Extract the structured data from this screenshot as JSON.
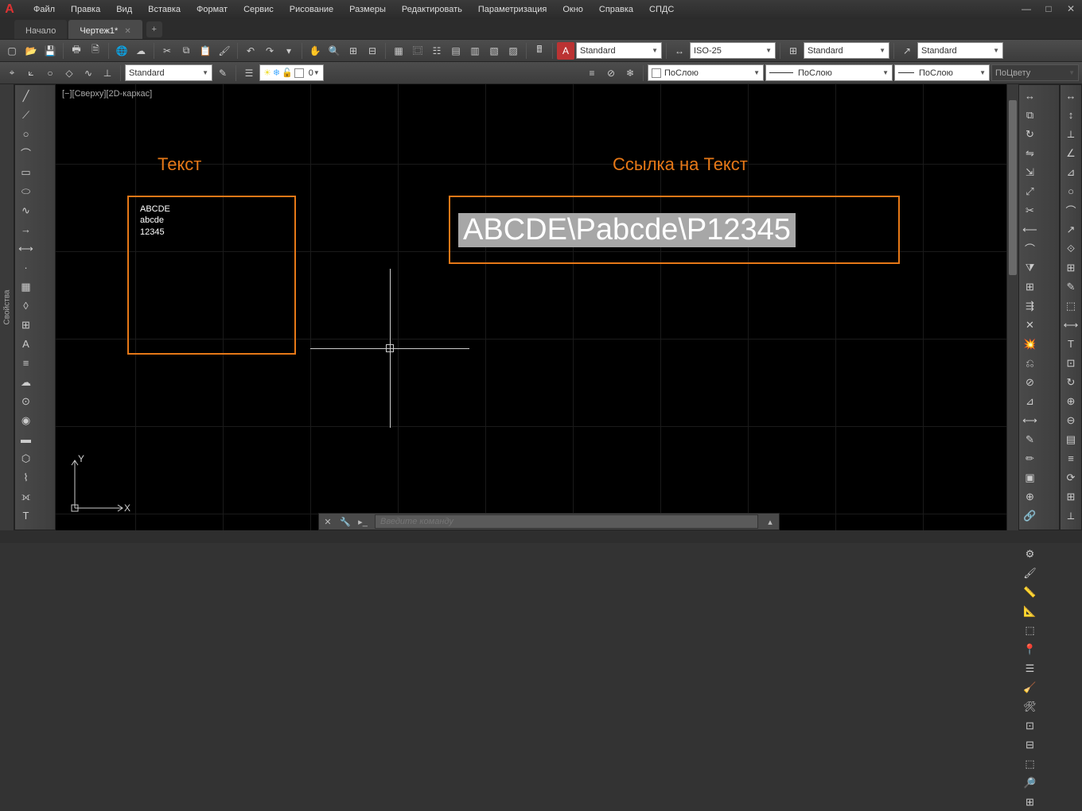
{
  "menu": [
    "Файл",
    "Правка",
    "Вид",
    "Вставка",
    "Формат",
    "Сервис",
    "Рисование",
    "Размеры",
    "Редактировать",
    "Параметризация",
    "Окно",
    "Справка",
    "СПДС"
  ],
  "tabs": {
    "start": "Начало",
    "active": "Чертеж1*"
  },
  "toolbar1": {
    "textStyle": "Standard",
    "dimStyle": "ISO-25",
    "tableStyle": "Standard",
    "mleaderStyle": "Standard"
  },
  "toolbar2": {
    "layerStyle": "Standard",
    "layerState": "0",
    "colorBy": "ПоСлою",
    "linetypeBy": "ПоСлою",
    "lineweightBy": "ПоСлою",
    "plotBy": "ПоЦвету"
  },
  "sidePanel": "Свойства",
  "viewport": "[−][Сверху][2D-каркас]",
  "labels": {
    "text": "Текст",
    "link": "Ссылка на Текст"
  },
  "mtext": {
    "l1": "ABCDE",
    "l2": "abcde",
    "l3": "12345"
  },
  "fieldText": "ABCDE\\Pabcde\\P12345",
  "ucs": {
    "x": "X",
    "y": "Y"
  },
  "cmd": {
    "placeholder": "Введите команду"
  },
  "icons": {
    "left": [
      "line",
      "polyline",
      "circle",
      "arc",
      "rect",
      "ellipse",
      "spline",
      "ray",
      "xline",
      "point",
      "hatch",
      "region",
      "table",
      "mtext",
      "mline",
      "revcloud",
      "wipeout",
      "donut",
      "solid",
      "boundary",
      "helix",
      "3dpoly",
      "text",
      "A"
    ],
    "right_a": [
      "move",
      "copy",
      "rotate",
      "mirror",
      "stretch",
      "scale",
      "trim",
      "extend",
      "fillet",
      "chamfer",
      "array",
      "offset",
      "erase",
      "explode",
      "join",
      "break",
      "align",
      "lengthen",
      "ped",
      "sped",
      "block",
      "insert",
      "xref",
      "layer",
      "prop",
      "match",
      "meas",
      "dist",
      "area",
      "id",
      "list",
      "purge",
      "audit",
      "group",
      "ungroup",
      "sel",
      "find",
      "qselect"
    ],
    "right_b": [
      "dim1",
      "dim2",
      "dim3",
      "dim4",
      "dim5",
      "dim6",
      "dim7",
      "dim8",
      "dim9",
      "dim10",
      "dim11",
      "dim12",
      "dim13",
      "dim14",
      "dim15",
      "dim16",
      "dim17",
      "dim18",
      "dim19",
      "dim20",
      "dim21",
      "dim22",
      "dim23",
      "dim24"
    ]
  }
}
